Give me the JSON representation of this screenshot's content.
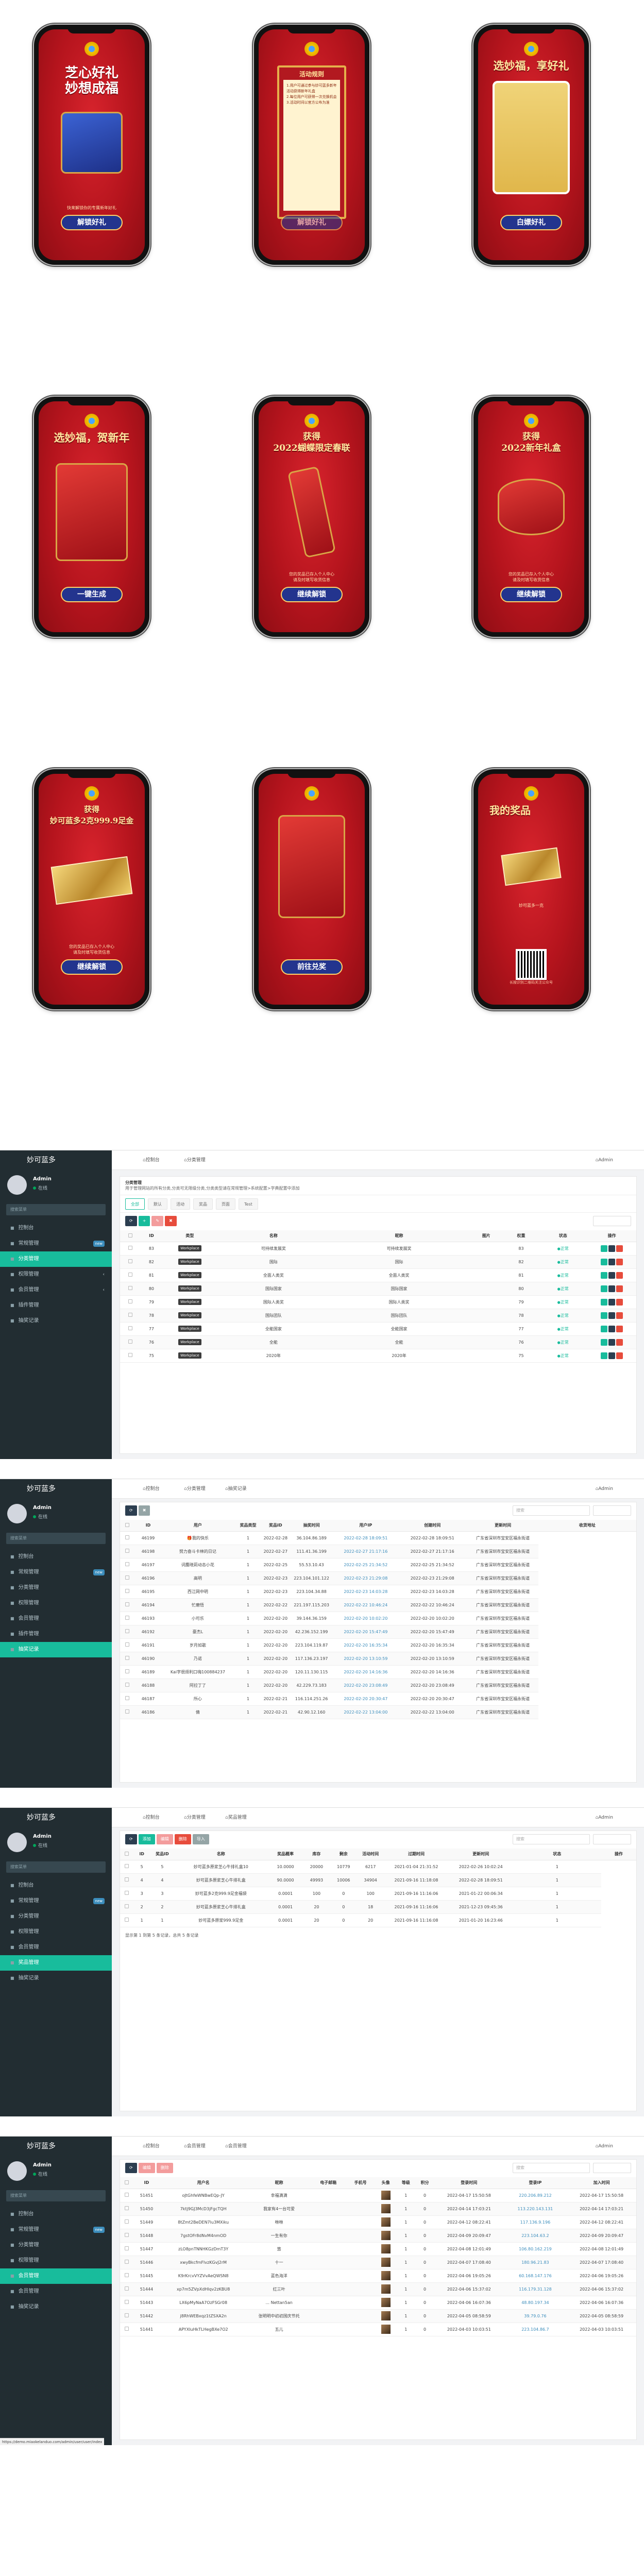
{
  "phones": [
    {
      "title": "芝心好礼\n妙想成福",
      "button": "解锁好礼",
      "tip": "快来解锁你的专属新年好礼",
      "foot": ""
    },
    {
      "title": "",
      "scroll_title": "活动规则",
      "scroll_text": "1.用户可通过参与妙可蓝多新年活动获得新年礼盒\n2.每位用户可获得一次兑换机会\n3.活动时间以官方公布为准",
      "button": "解锁好礼",
      "tip": "",
      "foot": ""
    },
    {
      "title": "选妙福，享好礼",
      "button": "白嫖好礼",
      "tip": "",
      "foot": ""
    },
    {
      "title": "选妙福，贺新年",
      "button": "一键生成",
      "tip": "",
      "foot": ""
    },
    {
      "title": "获得\n2022蝴蝶限定春联",
      "button": "继续解锁",
      "tip": "您的奖品已存入个人中心\n请及时填写收货信息",
      "foot": ""
    },
    {
      "title": "获得\n2022新年礼盒",
      "button": "继续解锁",
      "tip": "您的奖品已存入个人中心\n请及时填写收货信息",
      "foot": ""
    },
    {
      "title": "获得\n妙可蓝多2克999.9足金",
      "button": "继续解锁",
      "tip": "您的奖品已存入个人中心\n请及时填写收货信息",
      "foot": ""
    },
    {
      "title": "",
      "button": "前往兑奖",
      "tip": "",
      "foot": ""
    },
    {
      "title": "我的奖品",
      "button": "",
      "tip": "妙可蓝多一克",
      "foot": "长按识别二维码关注公众号"
    }
  ],
  "app": {
    "brand": "妙可蓝多",
    "user_name": "Admin",
    "user_status": "在线",
    "search_placeholder": "搜索菜单",
    "section": "菜单管理",
    "nav_home": "控制台",
    "admin_label": "Admin"
  },
  "panel1": {
    "nav": [
      {
        "label": "控制台",
        "badge": ""
      },
      {
        "label": "常规管理",
        "badge": "new"
      },
      {
        "label": "分类管理",
        "badge": ""
      },
      {
        "label": "权限管理",
        "badge": ""
      },
      {
        "label": "会员管理",
        "badge": ""
      },
      {
        "label": "插件管理",
        "badge": ""
      },
      {
        "label": "抽奖记录",
        "badge": ""
      }
    ],
    "top_tabs": [
      "控制台",
      "分类管理"
    ],
    "notice_title": "分类管理",
    "notice_text": "用于管理网站的所有分类,分类可无限级分类,分类类型请在常规管理>系统配置>字典配置中添加",
    "tabs": [
      "全部",
      "默认",
      "活动",
      "奖品",
      "页面",
      "Test"
    ],
    "columns": [
      "",
      "ID",
      "类型",
      "名称",
      "昵称",
      "图片",
      "权重",
      "状态",
      "操作"
    ],
    "rows": [
      [
        "",
        "83",
        "Workplace",
        "可持续发展奖",
        "可持续发展奖",
        "",
        "83",
        "正常",
        ""
      ],
      [
        "",
        "82",
        "Workplace",
        "国际",
        "国际",
        "",
        "82",
        "正常",
        ""
      ],
      [
        "",
        "81",
        "Workplace",
        "全面人类奖",
        "全面人类奖",
        "",
        "81",
        "正常",
        ""
      ],
      [
        "",
        "80",
        "Workplace",
        "国际国家",
        "国际国家",
        "",
        "80",
        "正常",
        ""
      ],
      [
        "",
        "79",
        "Workplace",
        "国际人类奖",
        "国际人类奖",
        "",
        "79",
        "正常",
        ""
      ],
      [
        "",
        "78",
        "Workplace",
        "国际团队",
        "国际团队",
        "",
        "78",
        "正常",
        ""
      ],
      [
        "",
        "77",
        "Workplace",
        "全能国家",
        "全能国家",
        "",
        "77",
        "正常",
        ""
      ],
      [
        "",
        "76",
        "Workplace",
        "全能",
        "全能",
        "",
        "76",
        "正常",
        ""
      ],
      [
        "",
        "75",
        "Workplace",
        "2020年",
        "2020年",
        "",
        "75",
        "正常",
        ""
      ]
    ]
  },
  "panel2": {
    "nav": [
      {
        "label": "控制台",
        "badge": ""
      },
      {
        "label": "常规管理",
        "badge": "new"
      },
      {
        "label": "分类管理",
        "badge": ""
      },
      {
        "label": "权限管理",
        "badge": ""
      },
      {
        "label": "会员管理",
        "badge": ""
      },
      {
        "label": "插件管理",
        "badge": ""
      },
      {
        "label": "抽奖记录",
        "badge": ""
      }
    ],
    "top_tabs": [
      "控制台",
      "分类管理",
      "抽奖记录"
    ],
    "search": "搜索",
    "columns": [
      "",
      "ID",
      "用户",
      "奖品类型",
      "奖品ID",
      "抽奖时间",
      "用户IP",
      "创建时间",
      "更新时间",
      "收货地址"
    ],
    "rows": [
      [
        "",
        "46199",
        "🎁我的快乐",
        "1",
        "2022-02-28",
        "36.104.86.189",
        "2022-02-28 18:09:51",
        "2022-02-28 18:09:51",
        "广东省深圳市宝安区福永街道"
      ],
      [
        "",
        "46198",
        "努力奋斗卡林的日记",
        "1",
        "2022-02-27",
        "111.41.36.199",
        "2022-02-27 21:17:16",
        "2022-02-27 21:17:16",
        "广东省深圳市宝安区福永街道"
      ],
      [
        "",
        "46197",
        "词麋晓莉动态小花",
        "1",
        "2022-02-25",
        "55.53.10.43",
        "2022-02-25 21:34:52",
        "2022-02-25 21:34:52",
        "广东省深圳市宝安区福永街道"
      ],
      [
        "",
        "46196",
        "高明",
        "1",
        "2022-02-23",
        "223.104.101.122",
        "2022-02-23 21:29:08",
        "2022-02-23 21:29:08",
        "广东省深圳市宝安区福永街道"
      ],
      [
        "",
        "46195",
        "西江网中明",
        "1",
        "2022-02-23",
        "223.104.34.88",
        "2022-02-23 14:03:28",
        "2022-02-23 14:03:28",
        "广东省深圳市宝安区福永街道"
      ],
      [
        "",
        "46194",
        "忙磨悟",
        "1",
        "2022-02-22",
        "221.197.115.203",
        "2022-02-22 10:46:24",
        "2022-02-22 10:46:24",
        "广东省深圳市宝安区福永街道"
      ],
      [
        "",
        "46193",
        "小可乐",
        "1",
        "2022-02-20",
        "39.144.36.159",
        "2022-02-20 10:02:20",
        "2022-02-20 10:02:20",
        "广东省深圳市宝安区福永街道"
      ],
      [
        "",
        "46192",
        "豪杰L",
        "1",
        "2022-02-20",
        "42.236.152.199",
        "2022-02-20 15:47:49",
        "2022-02-20 15:47:49",
        "广东省深圳市宝安区福永街道"
      ],
      [
        "",
        "46191",
        "岁月如歌",
        "1",
        "2022-02-20",
        "223.104.119.87",
        "2022-02-20 16:35:34",
        "2022-02-20 16:35:34",
        "广东省深圳市宝安区福永街道"
      ],
      [
        "",
        "46190",
        "乃诺",
        "1",
        "2022-02-20",
        "117.136.23.197",
        "2022-02-20 13:10:59",
        "2022-02-20 13:10:59",
        "广东省深圳市宝安区福永街道"
      ],
      [
        "",
        "46189",
        "Kai字很烦利口嗨100884237",
        "1",
        "2022-02-20",
        "120.11.130.115",
        "2022-02-20 14:16:36",
        "2022-02-20 14:16:36",
        "广东省深圳市宝安区福永街道"
      ],
      [
        "",
        "46188",
        "阿拉丁了",
        "1",
        "2022-02-20",
        "42.229.73.183",
        "2022-02-20 23:08:49",
        "2022-02-20 23:08:49",
        "广东省深圳市宝安区福永街道"
      ],
      [
        "",
        "46187",
        "所心",
        "1",
        "2022-02-21",
        "116.114.251.26",
        "2022-02-20 20:30:47",
        "2022-02-20 20:30:47",
        "广东省深圳市宝安区福永街道"
      ],
      [
        "",
        "46186",
        "倩",
        "1",
        "2022-02-21",
        "42.90.12.160",
        "2022-02-22 13:04:00",
        "2022-02-22 13:04:00",
        "广东省深圳市宝安区福永街道"
      ]
    ]
  },
  "panel3": {
    "nav": [
      {
        "label": "控制台",
        "badge": ""
      },
      {
        "label": "常规管理",
        "badge": "new"
      },
      {
        "label": "分类管理",
        "badge": ""
      },
      {
        "label": "权限管理",
        "badge": ""
      },
      {
        "label": "会员管理",
        "badge": ""
      },
      {
        "label": "奖品管理",
        "badge": ""
      },
      {
        "label": "抽奖记录",
        "badge": ""
      }
    ],
    "top_tabs": [
      "控制台",
      "分类管理",
      "奖品管理"
    ],
    "buttons": [
      "添加",
      "编辑",
      "删除",
      "导入"
    ],
    "search": "搜索",
    "columns": [
      "",
      "ID",
      "奖品ID",
      "名称",
      "奖品概率",
      "库存",
      "剩余",
      "活动时间",
      "过期时间",
      "更新时间",
      "状态",
      "操作"
    ],
    "rows": [
      [
        "",
        "5",
        "5",
        "妙可蓝多原浆芝心牛排礼盒10",
        "10.0000",
        "20000",
        "10779",
        "6217",
        "2021-01-04 21:31:52",
        "2022-02-26 10:02:24",
        "1"
      ],
      [
        "",
        "4",
        "4",
        "妙可蓝多原浆芝心牛排礼盒",
        "90.0000",
        "49993",
        "10006",
        "34904",
        "2021-09-16 11:18:08",
        "2022-02-28 18:09:51",
        "1"
      ],
      [
        "",
        "3",
        "3",
        "妙可蓝多2克999.9足金福袋",
        "0.0001",
        "100",
        "0",
        "100",
        "2021-09-16 11:16:06",
        "2021-01-22 00:06:34",
        "1"
      ],
      [
        "",
        "2",
        "2",
        "妙可蓝多原浆芝心牛排礼盒",
        "0.0001",
        "20",
        "0",
        "18",
        "2021-09-16 11:16:06",
        "2021-12-23 09:45:36",
        "1"
      ],
      [
        "",
        "1",
        "1",
        "妙可蓝多原浆999.9足金",
        "0.0001",
        "20",
        "0",
        "20",
        "2021-09-16 11:16:08",
        "2021-01-20 16:23:46",
        "1"
      ]
    ],
    "page_info": "显示第 1 到第 5 条记录，总共 5 条记录"
  },
  "panel4": {
    "nav": [
      {
        "label": "控制台",
        "badge": ""
      },
      {
        "label": "常规管理",
        "badge": "new"
      },
      {
        "label": "分类管理",
        "badge": ""
      },
      {
        "label": "权限管理",
        "badge": ""
      },
      {
        "label": "会员管理",
        "badge": ""
      },
      {
        "label": "会员管理",
        "badge": ""
      },
      {
        "label": "抽奖记录",
        "badge": ""
      }
    ],
    "top_tabs": [
      "控制台",
      "会员管理",
      "会员管理"
    ],
    "buttons": [
      "编辑",
      "删除"
    ],
    "search": "搜索",
    "columns": [
      "",
      "ID",
      "用户名",
      "昵称",
      "电子邮箱",
      "手机号",
      "头像",
      "等级",
      "积分",
      "登录时间",
      "登录IP",
      "加入时间"
    ],
    "rows": [
      [
        "",
        "51451",
        "oJtGhfeWNBwEQp-JY",
        "幸福满满",
        "",
        "",
        "",
        "1",
        "0",
        "2022-04-17 15:50:58",
        "220.206.89.212",
        "2022-04-17 15:50:58"
      ],
      [
        "",
        "51450",
        "7ktj9GJ3McD3jFgcTQH",
        "我家有4一台可爱",
        "",
        "",
        "",
        "1",
        "0",
        "2022-04-14 17:03:21",
        "113.220.143.131",
        "2022-04-14 17:03:21"
      ],
      [
        "",
        "51449",
        "8tZmt2BeDEN7lu3MXiku",
        "咻咻",
        "",
        "",
        "",
        "1",
        "0",
        "2022-04-12 08:22:41",
        "117.136.9.196",
        "2022-04-12 08:22:41"
      ],
      [
        "",
        "51448",
        "7gstOFr8dNvM4nmOD",
        "一生有你",
        "",
        "",
        "",
        "1",
        "0",
        "2022-04-09 20:09:47",
        "223.104.63.2",
        "2022-04-09 20:09:47"
      ],
      [
        "",
        "51447",
        "zLO8pnTNNHKGzDmT3Y",
        "悠",
        "",
        "",
        "",
        "1",
        "0",
        "2022-04-08 12:01:49",
        "106.80.162.219",
        "2022-04-08 12:01:49"
      ],
      [
        "",
        "51446",
        "xwyBkcfmFlvzKGvJ2rM",
        "十一",
        "",
        "",
        "",
        "1",
        "0",
        "2022-04-07 17:08:40",
        "180.96.21.83",
        "2022-04-07 17:08:40"
      ],
      [
        "",
        "51445",
        "K9rKrcvVYZVvAeQWSN8",
        "蓝色海洋",
        "",
        "",
        "",
        "1",
        "0",
        "2022-04-06 19:05:26",
        "60.168.147.176",
        "2022-04-06 19:05:26"
      ],
      [
        "",
        "51444",
        "xp7m5ZVpXdHlqv2zKBU8",
        "红三叶",
        "",
        "",
        "",
        "1",
        "0",
        "2022-04-06 15:37:02",
        "116.179.31.128",
        "2022-04-06 15:37:02"
      ],
      [
        "",
        "51443",
        "LX6pMyNaA7OzFSGr08",
        "... Nettan5an",
        "",
        "",
        "",
        "1",
        "0",
        "2022-04-06 16:07:36",
        "48.80.197.34",
        "2022-04-06 16:07:36"
      ],
      [
        "",
        "51442",
        "j8RhWEBxqz1tZSXA2n",
        "张明明中初初国庆节托",
        "",
        "",
        "",
        "1",
        "0",
        "2022-04-05 08:58:59",
        "39.79.0.76",
        "2022-04-05 08:58:59"
      ],
      [
        "",
        "51441",
        "APYXIuHkTLHegBXe7O2",
        "五儿",
        "",
        "",
        "",
        "1",
        "0",
        "2022-04-03 10:03:51",
        "223.104.86.7",
        "2022-04-03 10:03:51"
      ]
    ],
    "status_url": "https://demo.miaokelanduo.com/admin/user/user/index"
  }
}
